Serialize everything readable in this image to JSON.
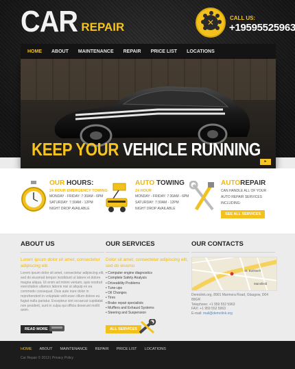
{
  "header": {
    "logo_main": "CAR",
    "logo_sub": "REPAIR",
    "call_label": "CALL US:",
    "phone": "+19595525963"
  },
  "nav": {
    "items": [
      {
        "label": "Home",
        "active": true
      },
      {
        "label": "About",
        "active": false
      },
      {
        "label": "Maintenance",
        "active": false
      },
      {
        "label": "Repair",
        "active": false
      },
      {
        "label": "Price List",
        "active": false
      },
      {
        "label": "Locations",
        "active": false
      }
    ]
  },
  "hero": {
    "headline_part1": "KEEP YOUR",
    "headline_part2": "VEHICLE RUNNING",
    "arrow_glyph": "▸"
  },
  "features": [
    {
      "title_accent": "OUR",
      "title_rest": "HOURS:",
      "subtitle": "24 HOUR EMERGENCY TOWING",
      "lines": [
        "MONDAY - FRIDAY: 7:30AM - 6PM",
        "SATURDAY: 7:30AM - 12PM",
        "NIGHT DROP AVAILABLE"
      ]
    },
    {
      "title_accent": "AUTO",
      "title_rest": "TOWING",
      "subtitle": "24 HOUR",
      "lines": [
        "MONDAY - FRIDAY: 7:30AM - 6PM",
        "SATURDAY: 7:30AM - 12PM",
        "NIGHT DROP AVAILABLE"
      ]
    },
    {
      "title_accent": "AUTO",
      "title_rest": "REPAIR",
      "lines": [
        "CAN HANDLE ALL OF YOUR",
        "AUTO REPAIR SERVICES",
        "INCLUDING:"
      ],
      "button": "SEE ALL SERVICES"
    }
  ],
  "about": {
    "title": "ABOUT US",
    "lead": "Lorem ipsum dolor sit amet, consectetur adipiscing elit.",
    "text": "Lorem ipsum dolor sit amet, consectetur adipiscing elit, sed do eiusmod tempor incididunt ut labore et dolore magna aliqua. Ut enim ad minim veniam, quis nostrud exercitation ullamco laboris nisi ut aliquip ex ea commodo consequat. Duis aute irure dolor in reprehenderit in voluptate velit esse cillum dolore eu fugiat nulla pariatur. Excepteur sint occaecat cupidatat non proident, sunt in culpa qui officia deserunt mollit anim.",
    "button": "READ MORE"
  },
  "services": {
    "title": "OUR SERVICES",
    "lead": "Dolor sit amet, consectetur adipiscing elit, sed do eiusmo",
    "items": [
      "Computer engine diagnostics",
      "Complete Safety Analysis",
      "Driveability Problems",
      "Tune-ups",
      "Oil Changes",
      "Tires",
      "Brake repair specialists",
      "Mufflers and Exhaust Systems",
      "Steering and Suspension"
    ],
    "button": "ALL SERVICES"
  },
  "contacts": {
    "title": "OUR CONTACTS",
    "map_street_1": "St. Bothwell",
    "map_street_2": "Mansfield",
    "lines": [
      "Demolink.org, 8901 Marmora Road, Glasgow, D04 89GR",
      "Telephone: +1 959 552 5963",
      "FAX: +1 959 552 5963",
      "E-mail: mail@demolink.org"
    ],
    "email": "mail@demolink.org"
  },
  "footer": {
    "nav": [
      "Home",
      "About",
      "Maintenance",
      "Repair",
      "Price List",
      "Locations"
    ],
    "copyright": "Car Repair © 2013 | Privacy Policy"
  },
  "colors": {
    "accent": "#f6c421",
    "dark": "#1c1c1c"
  }
}
